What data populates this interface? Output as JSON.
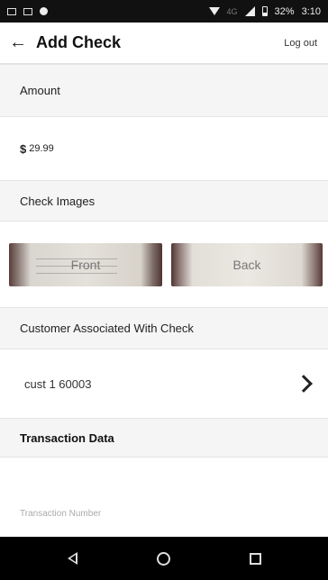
{
  "status_bar": {
    "network": "4G",
    "battery": "32%",
    "time": "3:10"
  },
  "app_bar": {
    "title": "Add Check",
    "logout_label": "Log out"
  },
  "sections": {
    "amount_header": "Amount",
    "check_images_header": "Check Images",
    "customer_header": "Customer Associated With Check",
    "transaction_header": "Transaction Data"
  },
  "amount": {
    "currency_symbol": "$",
    "value": "29.99"
  },
  "check_images": {
    "front_label": "Front",
    "back_label": "Back"
  },
  "customer": {
    "name": "cust 1 60003"
  },
  "transaction": {
    "number_placeholder": "Transaction Number"
  }
}
